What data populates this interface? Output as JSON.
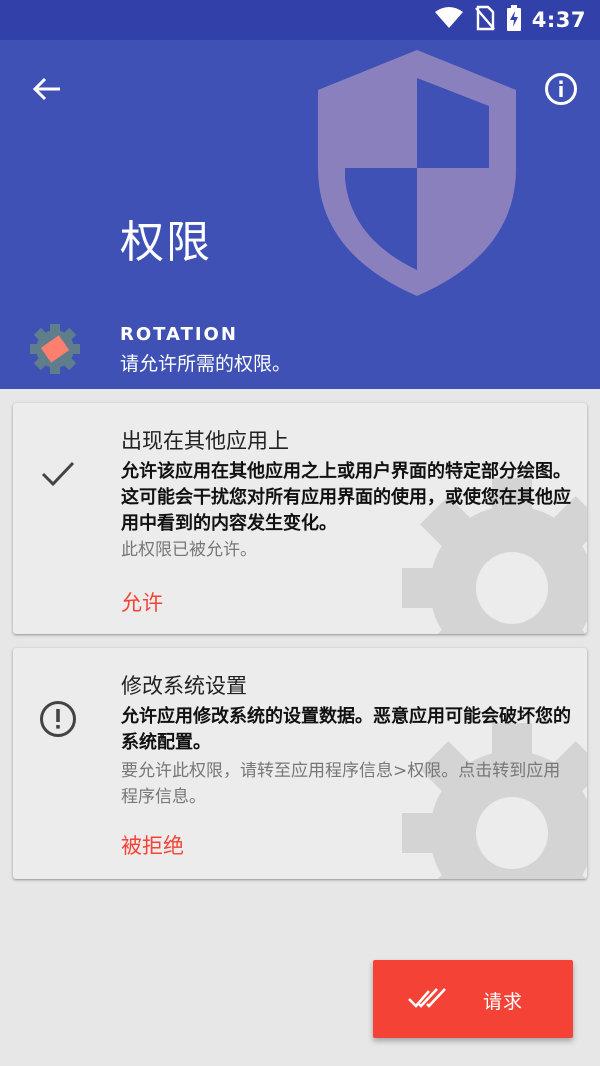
{
  "status_bar": {
    "time": "4:37",
    "icons": [
      "wifi-icon",
      "no-sim-icon",
      "battery-charging-icon"
    ]
  },
  "header": {
    "title": "权限",
    "app_name": "ROTATION",
    "subtitle": "请允许所需的权限。",
    "back_icon": "back-arrow-icon",
    "info_icon": "info-icon",
    "background_color": "#3f51b5",
    "shield_color": "#8a80bd"
  },
  "permissions": [
    {
      "title": "出现在其他应用上",
      "description": "允许该应用在其他应用之上或用户界面的特定部分绘图。这可能会干扰您对所有应用界面的使用，或使您在其他应用中看到的内容发生变化。",
      "note": "此权限已被允许。",
      "action": "允许",
      "status_icon": "check-icon"
    },
    {
      "title": "修改系统设置",
      "description": "允许应用修改系统的设置数据。恶意应用可能会破坏您的系统配置。",
      "note": "要允许此权限，请转至应用程序信息>权限。点击转到应用程序信息。",
      "action": "被拒绝",
      "status_icon": "alert-circle-icon"
    }
  ],
  "fab": {
    "label": "请求",
    "icon": "double-check-icon",
    "color": "#f44336"
  }
}
